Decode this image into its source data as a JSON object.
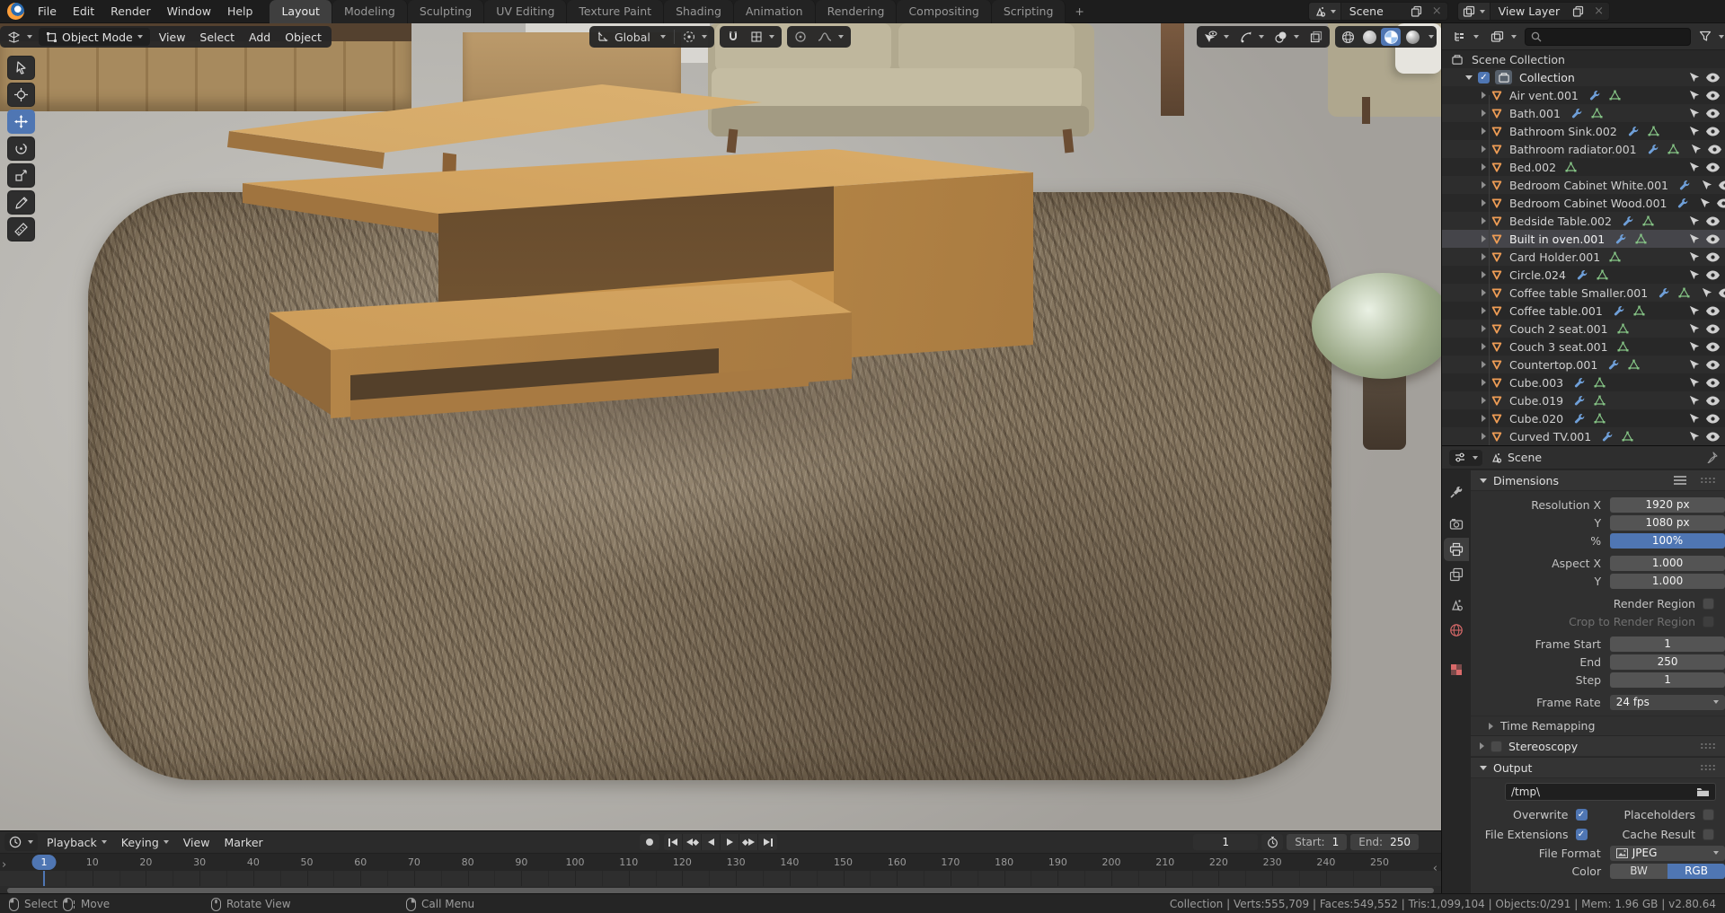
{
  "topbar": {
    "menus": [
      "File",
      "Edit",
      "Render",
      "Window",
      "Help"
    ],
    "workspaces": [
      {
        "label": "Layout",
        "active": true
      },
      {
        "label": "Modeling"
      },
      {
        "label": "Sculpting"
      },
      {
        "label": "UV Editing"
      },
      {
        "label": "Texture Paint"
      },
      {
        "label": "Shading"
      },
      {
        "label": "Animation"
      },
      {
        "label": "Rendering"
      },
      {
        "label": "Compositing"
      },
      {
        "label": "Scripting"
      }
    ],
    "add_workspace": "+",
    "scene_label": "Scene",
    "view_layer_label": "View Layer",
    "close_glyph": "×"
  },
  "viewport": {
    "mode": "Object Mode",
    "menus": [
      "View",
      "Select",
      "Add",
      "Object"
    ],
    "orientation": "Global",
    "tools": [
      "select-box",
      "cursor",
      "move",
      "rotate",
      "scale",
      "annotate",
      "measure"
    ],
    "active_tool": "move"
  },
  "outliner": {
    "root": "Scene Collection",
    "collection": "Collection",
    "items": [
      {
        "name": "Air vent.001",
        "wrench": true,
        "mesh": true
      },
      {
        "name": "Bath.001",
        "wrench": true,
        "mesh": true
      },
      {
        "name": "Bathroom Sink.002",
        "wrench": true,
        "mesh": true
      },
      {
        "name": "Bathroom radiator.001",
        "wrench": true,
        "mesh": true
      },
      {
        "name": "Bed.002",
        "mesh": true
      },
      {
        "name": "Bedroom Cabinet White.001",
        "wrench": true
      },
      {
        "name": "Bedroom Cabinet Wood.001",
        "wrench": true
      },
      {
        "name": "Bedside Table.002",
        "wrench": true,
        "mesh": true
      },
      {
        "name": "Built in oven.001",
        "wrench": true,
        "mesh": true,
        "selected": true
      },
      {
        "name": "Card Holder.001",
        "mesh": true
      },
      {
        "name": "Circle.024",
        "wrench": true,
        "mesh": true
      },
      {
        "name": "Coffee table Smaller.001",
        "wrench": true,
        "mesh": true
      },
      {
        "name": "Coffee table.001",
        "wrench": true,
        "mesh": true
      },
      {
        "name": "Couch 2 seat.001",
        "mesh": true
      },
      {
        "name": "Couch 3 seat.001",
        "mesh": true
      },
      {
        "name": "Countertop.001",
        "wrench": true,
        "mesh": true
      },
      {
        "name": "Cube.003",
        "wrench": true,
        "mesh": true
      },
      {
        "name": "Cube.019",
        "wrench": true,
        "mesh": true
      },
      {
        "name": "Cube.020",
        "wrench": true,
        "mesh": true
      },
      {
        "name": "Curved TV.001",
        "wrench": true,
        "mesh": true
      }
    ]
  },
  "properties": {
    "breadcrumb": "Scene",
    "dimensions": {
      "title": "Dimensions",
      "res_x_label": "Resolution X",
      "res_x": "1920 px",
      "res_y_label": "Y",
      "res_y": "1080 px",
      "pct_label": "%",
      "pct": "100%",
      "aspect_x_label": "Aspect X",
      "aspect_x": "1.000",
      "aspect_y_label": "Y",
      "aspect_y": "1.000",
      "render_region_label": "Render Region",
      "crop_region_label": "Crop to Render Region",
      "frame_start_label": "Frame Start",
      "frame_start": "1",
      "frame_end_label": "End",
      "frame_end": "250",
      "frame_step_label": "Step",
      "frame_step": "1",
      "frame_rate_label": "Frame Rate",
      "frame_rate": "24 fps"
    },
    "time_remapping_label": "Time Remapping",
    "stereoscopy_label": "Stereoscopy",
    "output": {
      "title": "Output",
      "path": "/tmp\\",
      "overwrite_label": "Overwrite",
      "placeholders_label": "Placeholders",
      "file_extensions_label": "File Extensions",
      "cache_result_label": "Cache Result",
      "file_format_label": "File Format",
      "file_format": "JPEG",
      "color_label": "Color",
      "color_bw": "BW",
      "color_rgb": "RGB"
    },
    "check_glyph": "✓"
  },
  "timeline": {
    "menus": [
      {
        "label": "Playback",
        "chev": true
      },
      {
        "label": "Keying",
        "chev": true
      },
      {
        "label": "View"
      },
      {
        "label": "Marker"
      }
    ],
    "current_frame": "1",
    "frame_badge": "1",
    "start_label": "Start:",
    "start_value": "1",
    "end_label": "End:",
    "end_value": "250",
    "ticks": [
      10,
      20,
      30,
      40,
      50,
      60,
      70,
      80,
      90,
      100,
      110,
      120,
      130,
      140,
      150,
      160,
      170,
      180,
      190,
      200,
      210,
      220,
      230,
      240,
      250
    ]
  },
  "statusbar": {
    "hints": [
      {
        "label": "Select"
      },
      {
        "label": "Move"
      },
      {
        "label": "Rotate View"
      },
      {
        "label": "Call Menu"
      }
    ],
    "stats": "Collection | Verts:555,709 | Faces:549,552 | Tris:1,099,104 | Objects:0/291 | Mem: 1.96 GB | v2.80.64"
  },
  "colors": {
    "accent": "#4f76b3",
    "selected_object": "#e8883f"
  }
}
